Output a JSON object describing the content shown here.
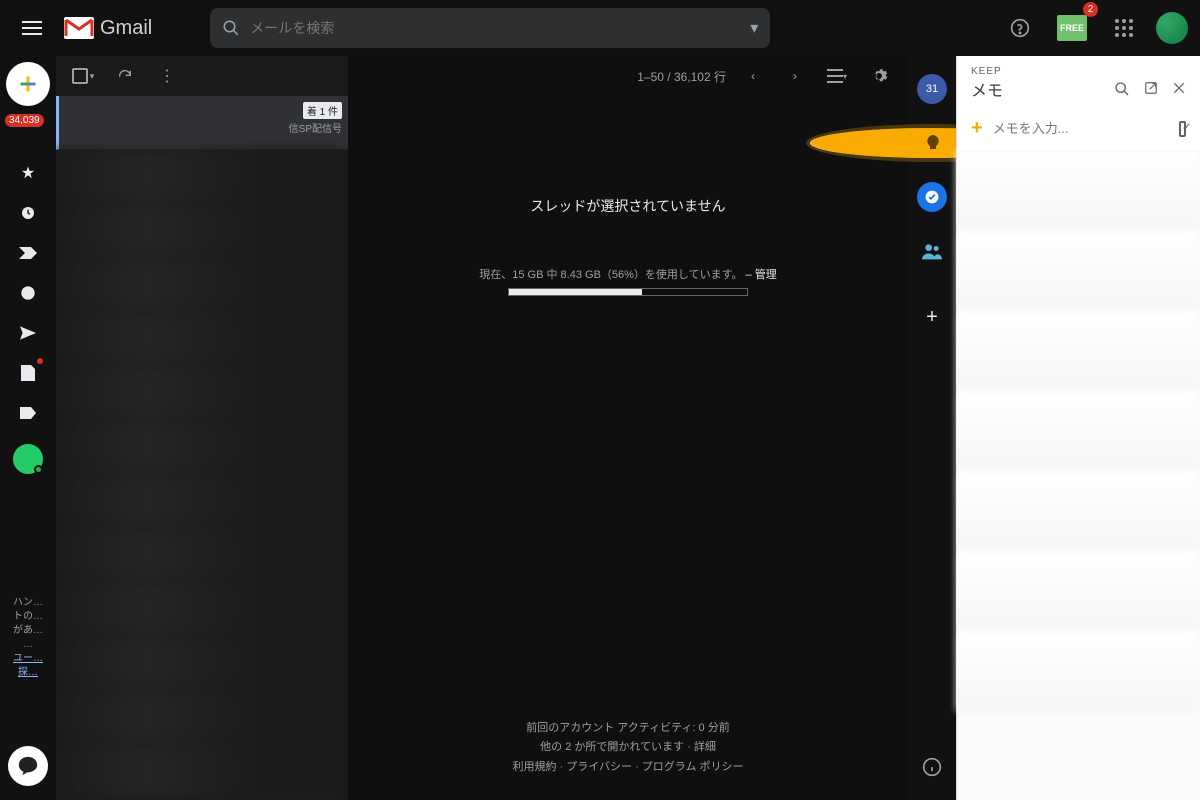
{
  "header": {
    "product": "Gmail",
    "search_placeholder": "メールを検索",
    "free_badge": "FREE",
    "free_count": "2"
  },
  "rail": {
    "inbox_badge": "34,039"
  },
  "hangouts": {
    "text1": "ハン…",
    "text2": "トの…",
    "text3": "があ…",
    "text4": "…",
    "link1": "ユー…",
    "link2": "探…"
  },
  "list": {
    "selected_tag": "着 1 件",
    "selected_sub": "信SP配信号"
  },
  "pane": {
    "range": "1–50 / 36,102 行",
    "empty": "スレッドが選択されていません",
    "storage": "現在、15 GB 中 8.43 GB（56%）を使用しています。",
    "manage": "– 管理",
    "progress_pct": 56,
    "activity": "前回のアカウント アクティビティ: 0 分前",
    "other_sessions": "他の 2 か所で開かれています",
    "details": "詳細",
    "terms": "利用規約",
    "privacy": "プライバシー",
    "policy": "プログラム ポリシー"
  },
  "addons": {
    "calendar_day": "31"
  },
  "keep": {
    "app_label": "KEEP",
    "title": "メモ",
    "input_placeholder": "メモを入力..."
  }
}
